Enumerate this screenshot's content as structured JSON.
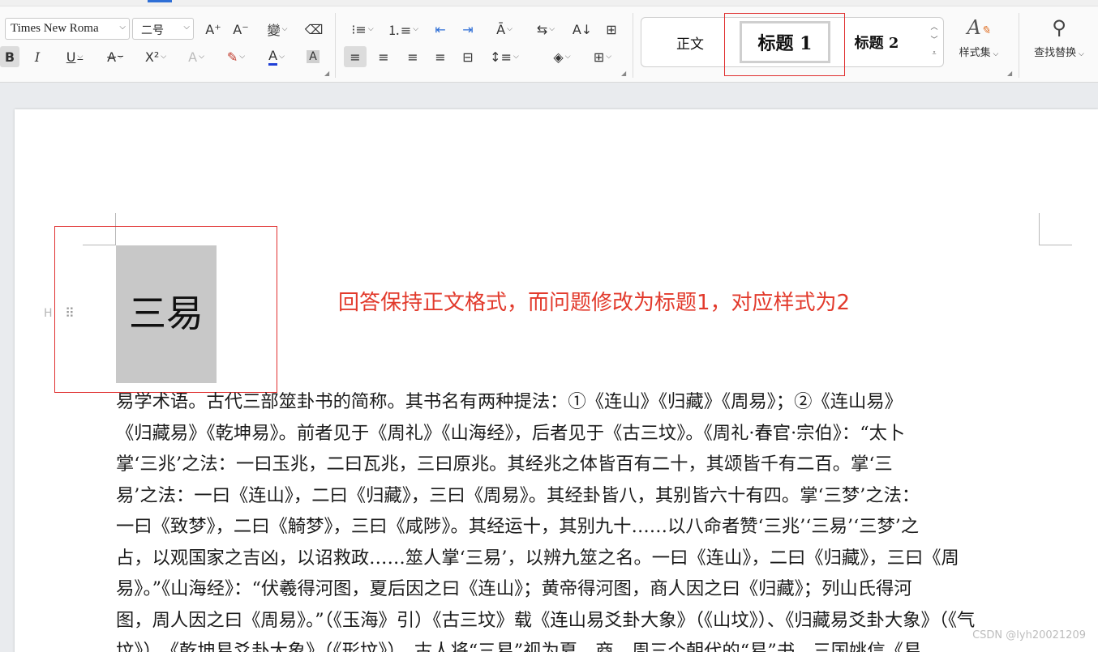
{
  "toolbar": {
    "font_name": "Times New Roma",
    "font_size": "二号",
    "row1_left": [
      {
        "name": "grow-font-icon",
        "glyph": "A⁺"
      },
      {
        "name": "shrink-font-icon",
        "glyph": "A⁻"
      },
      {
        "name": "phonetic-guide-icon",
        "glyph": "變"
      },
      {
        "name": "clear-format-icon",
        "glyph": "⌫"
      }
    ],
    "row2_left": [
      {
        "name": "bold-icon",
        "glyph": "B"
      },
      {
        "name": "italic-icon",
        "glyph": "I"
      },
      {
        "name": "underline-icon",
        "glyph": "U"
      },
      {
        "name": "strikethrough-icon",
        "glyph": "A"
      },
      {
        "name": "superscript-icon",
        "glyph": "X²"
      },
      {
        "name": "text-effect-icon",
        "glyph": "A"
      },
      {
        "name": "highlight-icon",
        "glyph": "✎"
      },
      {
        "name": "font-color-icon",
        "glyph": "A"
      },
      {
        "name": "char-shading-icon",
        "glyph": "A"
      }
    ],
    "para_row1": [
      {
        "name": "bullet-list-icon",
        "glyph": "⁝≡"
      },
      {
        "name": "numbered-list-icon",
        "glyph": "⒈≡"
      },
      {
        "name": "decrease-indent-icon",
        "glyph": "⇤"
      },
      {
        "name": "increase-indent-icon",
        "glyph": "⇥"
      },
      {
        "name": "text-direction-icon",
        "glyph": "Ā"
      },
      {
        "name": "sort-icon",
        "glyph": "⇆"
      },
      {
        "name": "sort-az-icon",
        "glyph": "A↓"
      },
      {
        "name": "columns-icon",
        "glyph": "⊞"
      }
    ],
    "para_row2": [
      {
        "name": "align-left-icon",
        "glyph": "≡"
      },
      {
        "name": "align-center-icon",
        "glyph": "≡"
      },
      {
        "name": "align-right-icon",
        "glyph": "≡"
      },
      {
        "name": "justify-icon",
        "glyph": "≡"
      },
      {
        "name": "distributed-icon",
        "glyph": "⊟"
      },
      {
        "name": "line-spacing-icon",
        "glyph": "↕≡"
      },
      {
        "name": "shading-icon",
        "glyph": "◈"
      },
      {
        "name": "borders-icon",
        "glyph": "⊞"
      }
    ],
    "styles": {
      "normal": "正文",
      "heading1": "标题 1",
      "heading2": "标题 2"
    },
    "style_set_label": "样式集",
    "find_replace_label": "查找替换"
  },
  "document": {
    "heading": "三易",
    "para_mark": "H",
    "annotation": "回答保持正文格式，而问题修改为标题1，对应样式为2",
    "body_lines": [
      "易学术语。古代三部筮卦书的简称。其书名有两种提法：①《连山》《归藏》《周易》；②《连山易》",
      "《归藏易》《乾坤易》。前者见于《周礼》《山海经》，后者见于《古三坟》。《周礼·春官·宗伯》：“太卜",
      "掌‘三兆’之法：一曰玉兆，二曰瓦兆，三曰原兆。其经兆之体皆百有二十，其颂皆千有二百。掌‘三",
      "易’之法：一曰《连山》，二曰《归藏》，三曰《周易》。其经卦皆八，其别皆六十有四。掌‘三梦’之法：",
      "一曰《致梦》，二曰《觭梦》，三曰《咸陟》。其经运十，其别九十……以八命者赞‘三兆’‘三易’‘三梦’之",
      "占，以观国家之吉凶，以诏救政……筮人掌‘三易’，以辨九筮之名。一曰《连山》，二曰《归藏》，三曰《周",
      "易》。”《山海经》：“伏羲得河图，夏后因之曰《连山》；黄帝得河图，商人因之曰《归藏》；列山氏得河",
      "图，周人因之曰《周易》。”（《玉海》引）《古三坟》载《连山易爻卦大象》（《山坟》）、《归藏易爻卦大象》（《气",
      "坟》）、《乾坤易爻卦大象》（《形坟》）。古人将“三易”视为夏、商、周三个朝代的“易”书。三国姚信《易"
    ]
  },
  "watermark": "CSDN @lyh20021209"
}
